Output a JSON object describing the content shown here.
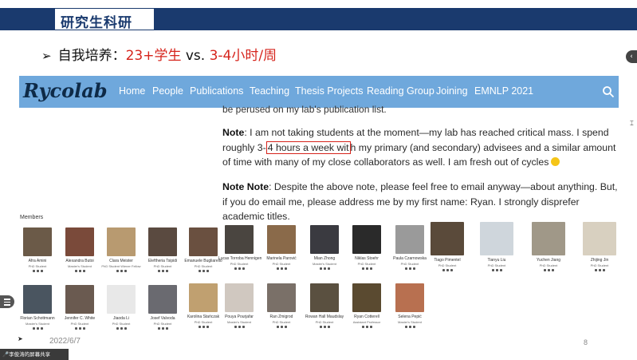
{
  "slide": {
    "title": "研究生科研",
    "bullet_prefix": "自我培养：",
    "bullet_red1": "23+学生",
    "bullet_mid": " vs. ",
    "bullet_red2": "3-4小时/周",
    "date": "2022/6/7",
    "page_number": "8"
  },
  "site": {
    "logo": "Rycolab",
    "nav": [
      "Home",
      "People",
      "Publications",
      "Teaching",
      "Thesis Projects",
      "Reading Group",
      "Joining",
      "EMNLP 2021"
    ],
    "cut_line": "be perused on my lab's publication list.",
    "note_label": "Note",
    "note_part1": ": I am not taking students at the moment—my lab has reached critical mass. I spend roughly 3-",
    "note_highlight": "4 hours a week wit",
    "note_part2": "h my primary (and secondary) advisees and a similar amount of time with many of my close collaborators as well. I am fresh out of cycles",
    "note2_label": "Note Note",
    "note2_text": ": Despite the above note, please feel free to email anyway—about anything. But, if you do email me, please address me by my first name: Ryan. I strongly disprefer academic titles.",
    "members_label": "Members"
  },
  "members": [
    {
      "name": "Afra Amini",
      "role": "PhD Student",
      "color": "#6b5a48"
    },
    {
      "name": "Alexandra Butoi",
      "role": "Master's Student",
      "color": "#7a4a3a"
    },
    {
      "name": "Clara Meister",
      "role": "PhD Student Wiener Fellow",
      "color": "#b89a70"
    },
    {
      "name": "Eleftheria Tsipidi",
      "role": "PhD Student",
      "color": "#5a4a40"
    },
    {
      "name": "Emanuele Bugliarello",
      "role": "PhD Student",
      "color": "#6a5040"
    },
    {
      "name": "Lucas Torroba Hennigen",
      "role": "PhD Student",
      "color": "#4a4540"
    },
    {
      "name": "Marinela Parović",
      "role": "PhD Student",
      "color": "#8a6a4a"
    },
    {
      "name": "Mian Zhong",
      "role": "Master's Student",
      "color": "#3a3a40"
    },
    {
      "name": "Niklas Stoehr",
      "role": "PhD Student",
      "color": "#2a2a2a"
    },
    {
      "name": "Paula Czarnowska",
      "role": "PhD Student",
      "color": "#9a9a9a"
    },
    {
      "name": "Tiago Pimentel",
      "role": "PhD Student",
      "color": "#5a4a3a"
    },
    {
      "name": "Tianyu Liu",
      "role": "PhD Student",
      "color": "#cfd6dc"
    },
    {
      "name": "Yuchen Jiang",
      "role": "PhD Student",
      "color": "#a09888"
    },
    {
      "name": "Zhijing Jin",
      "role": "PhD Student",
      "color": "#d8d0c0"
    },
    {
      "name": "Florian Schottmann",
      "role": "Master's Student",
      "color": "#4a5560"
    },
    {
      "name": "Jennifer C. White",
      "role": "PhD Student",
      "color": "#6a5a50"
    },
    {
      "name": "Jiaoda Li",
      "role": "PhD Student",
      "color": "#e8e8e8"
    },
    {
      "name": "Josef Valvoda",
      "role": "PhD Student",
      "color": "#6a6a70"
    },
    {
      "name": "Karolina Stańczak",
      "role": "PhD Student",
      "color": "#c0a070"
    },
    {
      "name": "Pouya Pourjafar",
      "role": "Master's Student",
      "color": "#d0c8c0"
    },
    {
      "name": "Ran Zmigrod",
      "role": "PhD Student",
      "color": "#7a7068"
    },
    {
      "name": "Rowan Hall Maudslay",
      "role": "PhD Student",
      "color": "#5a5040"
    },
    {
      "name": "Ryan Cotterell",
      "role": "Assistant Professor",
      "color": "#5a4a30"
    },
    {
      "name": "Selena Pepić",
      "role": "Master's Student",
      "color": "#b87050"
    }
  ],
  "share_bar": "李俊涛的屏幕共享",
  "colors": {
    "header": "#1a3a6e",
    "nav": "#6fa8dc",
    "accent": "#d6241c"
  }
}
